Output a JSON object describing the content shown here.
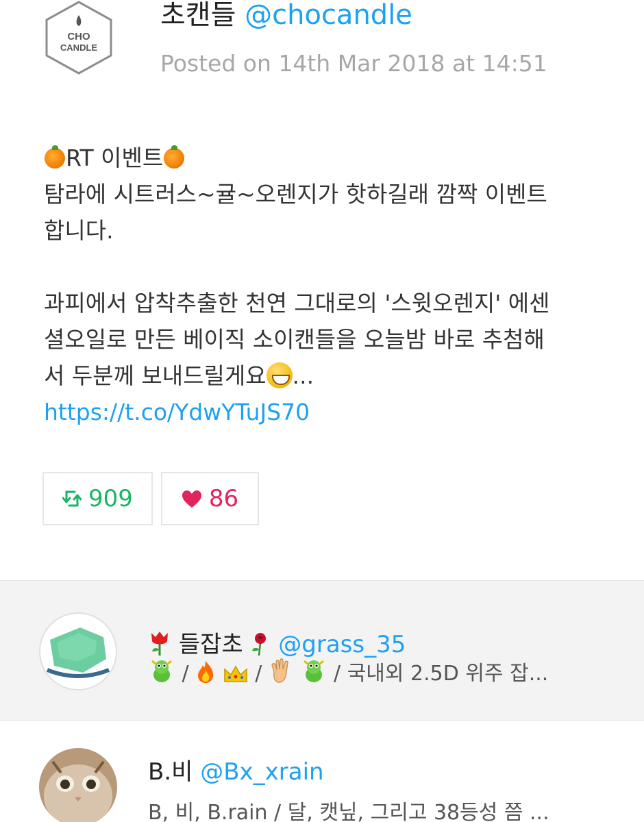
{
  "post": {
    "author_name": "초캔들",
    "author_handle": "@chocandle",
    "logo_text_top": "CHO",
    "logo_text_bottom": "CANDLE",
    "posted_on": "Posted on 14th Mar 2018 at 14:51",
    "body": {
      "line1_text": "RT 이벤트",
      "line2": "탐라에 시트러스~귤~오렌지가 핫하길래 깜짝 이벤트",
      "line3": "합니다.",
      "line5": "과피에서 압착추출한 천연 그대로의 '스윗오렌지' 에센",
      "line6": "셜오일로 만든 베이직 소이캔들을 오늘밤 바로 추첨해",
      "line7_text": "서 두분께 보내드릴게요",
      "line7_tail": "...",
      "link": "https://t.co/YdwYTuJS70"
    },
    "retweet_count": "909",
    "like_count": "86"
  },
  "users": [
    {
      "name": "들잡초",
      "handle": "@grass_35",
      "bio_text": "/ 국내외 2.5D 위주 잡...",
      "sep": "/"
    },
    {
      "name": "B.비",
      "handle": "@Bx_xrain",
      "bio_text": "B, 비, B.rain / 달, 캣닢, 그리고 38등성 쯤 ..."
    }
  ],
  "colors": {
    "link": "#1da1f2",
    "retweet": "#19b566",
    "like": "#e0245e",
    "meta": "#a7a7a7"
  },
  "icons": [
    "chocandle-logo",
    "tangerine-icon",
    "grin-icon",
    "retweet-icon",
    "heart-icon",
    "tulip-icon",
    "rose-icon",
    "dragon-icon",
    "fire-icon",
    "crown-icon",
    "hand-icon"
  ]
}
